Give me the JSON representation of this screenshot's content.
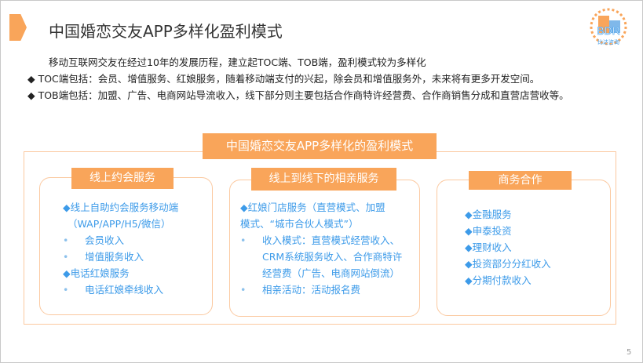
{
  "header": {
    "title": "中国婚恋交友APP多样化盈利模式",
    "logo_text": "BDR",
    "logo_sub": "比达咨询"
  },
  "intro": "移动互联网交友在经过10年的发展历程，建立起TOC端、TOB端，盈利模式较为多样化",
  "bullets": [
    "◆  TOC端包括：会员、增值服务、红娘服务，随着移动端支付的兴起，除会员和增值服务外，未来将有更多开发空间。",
    "◆  TOB端包括：加盟、广告、电商网站导流收入，线下部分则主要包括合作商特许经营费、合作商销售分成和直营店营收等。"
  ],
  "diagram": {
    "title": "中国婚恋交友APP多样化的盈利模式",
    "cards": [
      {
        "title": "线上约会服务",
        "lines": [
          "◆线上自助约会服务移动端",
          "（WAP/APP/H5/微信）",
          "会员收入",
          "增值服务收入",
          "◆电话红娘服务",
          "电话红娘牵线收入"
        ]
      },
      {
        "title": "线上到线下的相亲服务",
        "lines": [
          "◆红娘门店服务（直营模式、加盟",
          "模式、“城市合伙人模式”）",
          "收入模式：直营模式经营收入、",
          "CRM系统服务收入、合作商特许",
          "经营费（广告、电商网站倒流）",
          "相亲活动：活动报名费"
        ]
      },
      {
        "title": "商务合作",
        "lines": [
          "◆金融服务",
          "◆申泰投资",
          "◆理财收入",
          "◆投资部分分红收入",
          "◆分期付款收入"
        ]
      }
    ]
  },
  "page_number": "5",
  "colors": {
    "accent": "#f9a55a",
    "text_blue": "#3d9be9"
  }
}
